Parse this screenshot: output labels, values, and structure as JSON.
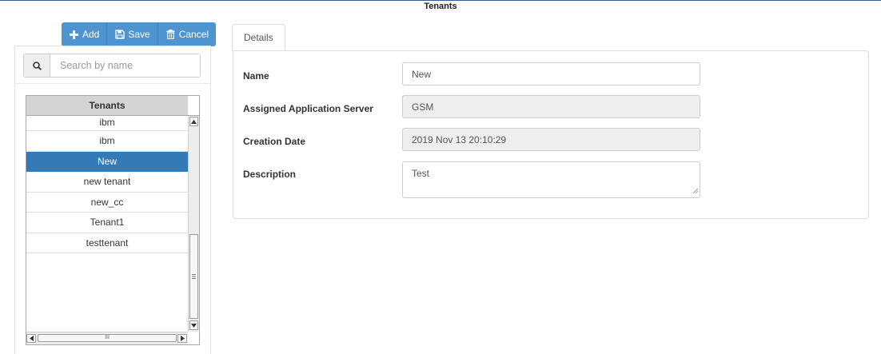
{
  "page": {
    "title": "Tenants"
  },
  "toolbar": {
    "add_label": "Add",
    "save_label": "Save",
    "cancel_label": "Cancel"
  },
  "search": {
    "placeholder": "Search by name",
    "value": ""
  },
  "grid": {
    "header": "Tenants",
    "rows": [
      "ibm",
      "ibm",
      "New",
      "new tenant",
      "new_cc",
      "Tenant1",
      "testtenant"
    ],
    "selected_index": 2,
    "hscroll_thumb_text": "III"
  },
  "tabs": [
    {
      "label": "Details",
      "active": true
    }
  ],
  "form": {
    "name_label": "Name",
    "name_value": "New",
    "server_label": "Assigned Application Server",
    "server_value": "GSM",
    "date_label": "Creation Date",
    "date_value": "2019 Nov 13 20:10:29",
    "description_label": "Description",
    "description_value": "Test"
  },
  "icons": {
    "add": "plus-icon",
    "save": "floppy-disk-icon",
    "cancel": "trash-icon",
    "search": "search-icon"
  },
  "colors": {
    "accent": "#4f94cf",
    "selected_row": "#337ab7",
    "title_rule": "#3a5f8a"
  }
}
